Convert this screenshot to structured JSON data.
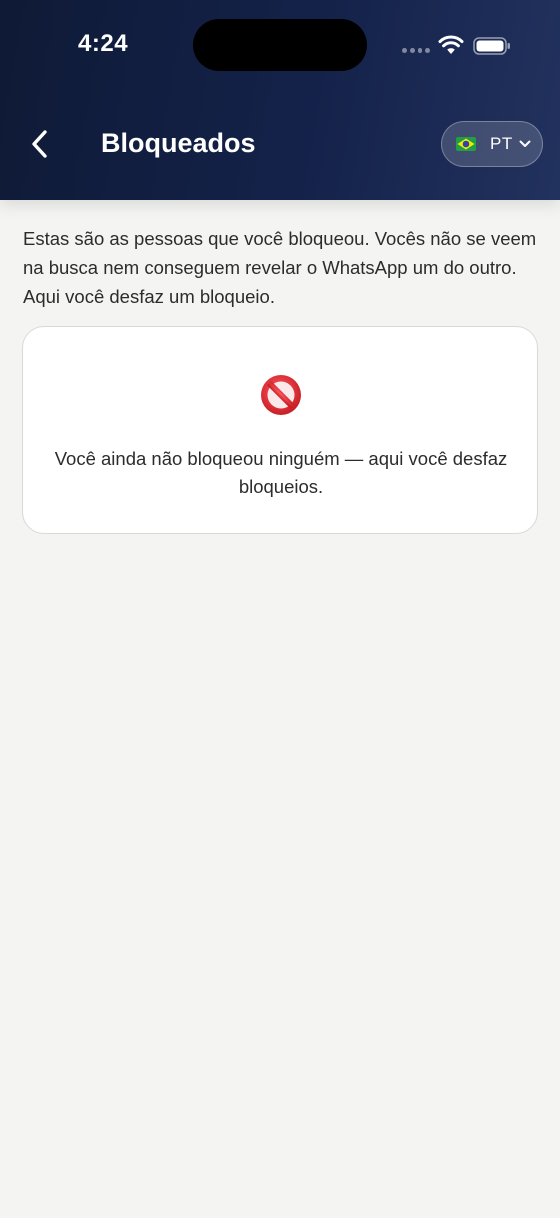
{
  "status_bar": {
    "time": "4:24"
  },
  "header": {
    "title": "Bloqueados",
    "back_icon": "chevron-left-icon",
    "language": {
      "label": "PT",
      "flag_icon": "brazil-flag-icon",
      "dropdown_icon": "chevron-down-icon"
    }
  },
  "intro_text": "Estas são as pessoas que você bloqueou. Vocês não se veem na busca nem conseguem revelar o WhatsApp um do outro. Aqui você desfaz um bloqueio.",
  "empty_state": {
    "icon": "prohibited-icon",
    "message": "Você ainda não bloqueou ninguém — aqui você desfaz bloqueios."
  },
  "colors": {
    "header_start": "#0f1a36",
    "header_end": "#22325e",
    "background": "#f4f5f2",
    "prohibited_red": "#d7282f"
  }
}
